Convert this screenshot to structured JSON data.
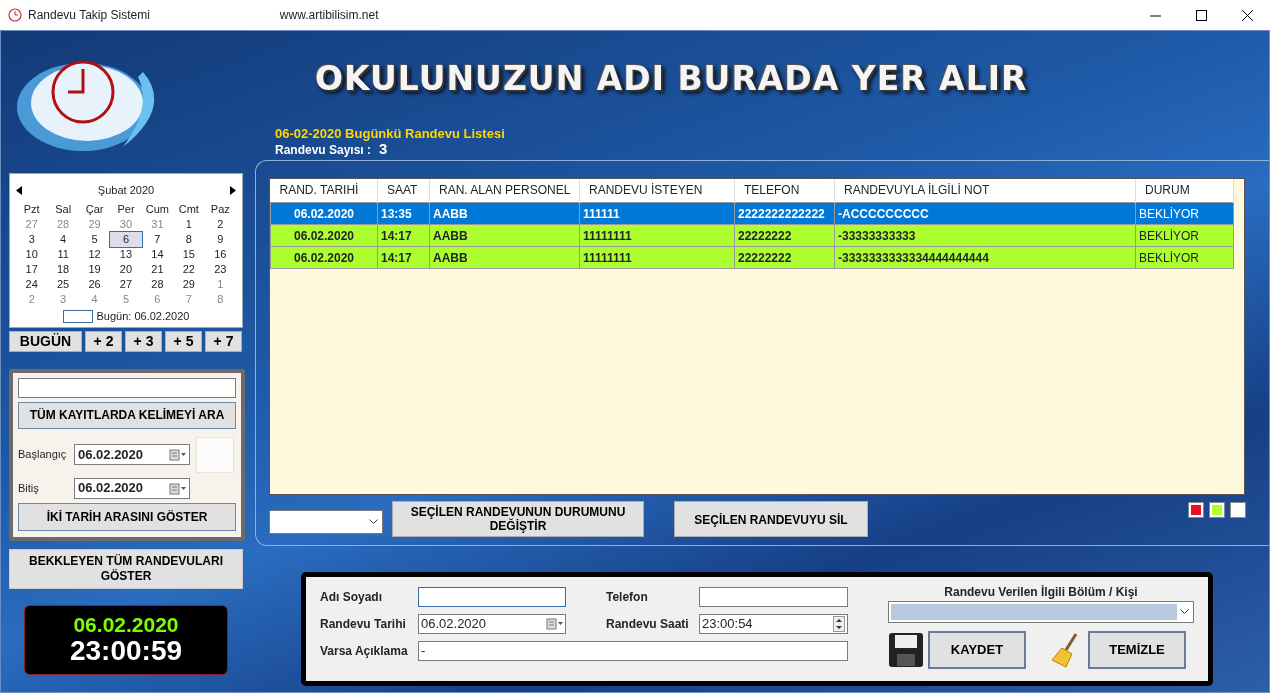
{
  "window": {
    "title": "Randevu Takip Sistemi",
    "url": "www.artibilisim.net"
  },
  "school_title": "OKULUNUZUN ADI BURADA YER ALIR",
  "calendar": {
    "month": "Şubat 2020",
    "weekdays": [
      "Pzt",
      "Sal",
      "Çar",
      "Per",
      "Cum",
      "Cmt",
      "Paz"
    ],
    "days": [
      {
        "d": "27",
        "other_month": true,
        "selected": false
      },
      {
        "d": "28",
        "other_month": true,
        "selected": false
      },
      {
        "d": "29",
        "other_month": true,
        "selected": false
      },
      {
        "d": "30",
        "other_month": true,
        "selected": false
      },
      {
        "d": "31",
        "other_month": true,
        "selected": false
      },
      {
        "d": "1",
        "other_month": false,
        "selected": false
      },
      {
        "d": "2",
        "other_month": false,
        "selected": false
      },
      {
        "d": "3",
        "other_month": false,
        "selected": false
      },
      {
        "d": "4",
        "other_month": false,
        "selected": false
      },
      {
        "d": "5",
        "other_month": false,
        "selected": false
      },
      {
        "d": "6",
        "other_month": false,
        "selected": true
      },
      {
        "d": "7",
        "other_month": false,
        "selected": false
      },
      {
        "d": "8",
        "other_month": false,
        "selected": false
      },
      {
        "d": "9",
        "other_month": false,
        "selected": false
      },
      {
        "d": "10",
        "other_month": false,
        "selected": false
      },
      {
        "d": "11",
        "other_month": false,
        "selected": false
      },
      {
        "d": "12",
        "other_month": false,
        "selected": false
      },
      {
        "d": "13",
        "other_month": false,
        "selected": false
      },
      {
        "d": "14",
        "other_month": false,
        "selected": false
      },
      {
        "d": "15",
        "other_month": false,
        "selected": false
      },
      {
        "d": "16",
        "other_month": false,
        "selected": false
      },
      {
        "d": "17",
        "other_month": false,
        "selected": false
      },
      {
        "d": "18",
        "other_month": false,
        "selected": false
      },
      {
        "d": "19",
        "other_month": false,
        "selected": false
      },
      {
        "d": "20",
        "other_month": false,
        "selected": false
      },
      {
        "d": "21",
        "other_month": false,
        "selected": false
      },
      {
        "d": "22",
        "other_month": false,
        "selected": false
      },
      {
        "d": "23",
        "other_month": false,
        "selected": false
      },
      {
        "d": "24",
        "other_month": false,
        "selected": false
      },
      {
        "d": "25",
        "other_month": false,
        "selected": false
      },
      {
        "d": "26",
        "other_month": false,
        "selected": false
      },
      {
        "d": "27",
        "other_month": false,
        "selected": false
      },
      {
        "d": "28",
        "other_month": false,
        "selected": false
      },
      {
        "d": "29",
        "other_month": false,
        "selected": false
      },
      {
        "d": "1",
        "other_month": true,
        "selected": false
      },
      {
        "d": "2",
        "other_month": true,
        "selected": false
      },
      {
        "d": "3",
        "other_month": true,
        "selected": false
      },
      {
        "d": "4",
        "other_month": true,
        "selected": false
      },
      {
        "d": "5",
        "other_month": true,
        "selected": false
      },
      {
        "d": "6",
        "other_month": true,
        "selected": false
      },
      {
        "d": "7",
        "other_month": true,
        "selected": false
      },
      {
        "d": "8",
        "other_month": true,
        "selected": false
      }
    ],
    "today": "Bugün: 06.02.2020"
  },
  "quick_buttons": [
    "BUGÜN",
    "+ 2",
    "+ 3",
    "+ 5",
    "+ 7"
  ],
  "search": {
    "button": "TÜM KAYITLARDA KELİMEYİ ARA",
    "start_label": "Başlangıç",
    "start": "06.02.2020",
    "end_label": "Bitiş",
    "end": "06.02.2020",
    "range_button": "İKİ TARİH ARASINI GÖSTER"
  },
  "pending_button": "BEKKLEYEN TÜM RANDEVULARI GÖSTER",
  "clock": {
    "date": "06.02.2020",
    "time": "23:00:59"
  },
  "list_title": "06-02-2020 Bugünkü Randevu Listesi",
  "count_label": "Randevu Sayısı :",
  "count": "3",
  "table": {
    "columns": [
      "RAND. TARIHİ",
      "SAAT",
      "RAN. ALAN PERSONEL",
      "RANDEVU İSTEYEN",
      "TELEFON",
      "RANDEVUYLA İLGİLİ NOT",
      "DURUM"
    ],
    "rows": [
      {
        "selected": true,
        "cells": [
          "06.02.2020",
          "13:35",
          "AABB",
          "111111",
          "2222222222222",
          "-ACCCCCCCCC",
          "BEKLİYOR"
        ]
      },
      {
        "selected": false,
        "color": "#adff2f",
        "cells": [
          "06.02.2020",
          "14:17",
          "AABB",
          "11111111",
          "22222222",
          "-33333333333",
          "BEKLİYOR"
        ]
      },
      {
        "selected": false,
        "color": "#adff2f",
        "cells": [
          "06.02.2020",
          "14:17",
          "AABB",
          "11111111",
          "22222222",
          "-3333333333334444444444",
          "BEKLİYOR"
        ]
      }
    ]
  },
  "change_status_button": "SEÇİLEN RANDEVUNUN DURUMUNU DEĞİŞTİR",
  "delete_button": "SEÇİLEN RANDEVUYU SİL",
  "legend": [
    {
      "color": "#e81123"
    },
    {
      "color": "#adff2f"
    },
    {
      "color": "#ffffff"
    }
  ],
  "form": {
    "name_label": "Adı Soyadı",
    "phone_label": "Telefon",
    "date_label": "Randevu Tarihi",
    "date": "06.02.2020",
    "time_label": "Randevu Saati",
    "time": "23:00:54",
    "note_label": "Varsa Açıklama",
    "note": "-",
    "dept_label": "Randevu Verilen İlgili Bölüm / Kişi",
    "save_button": "KAYDET",
    "clear_button": "TEMİZLE"
  }
}
